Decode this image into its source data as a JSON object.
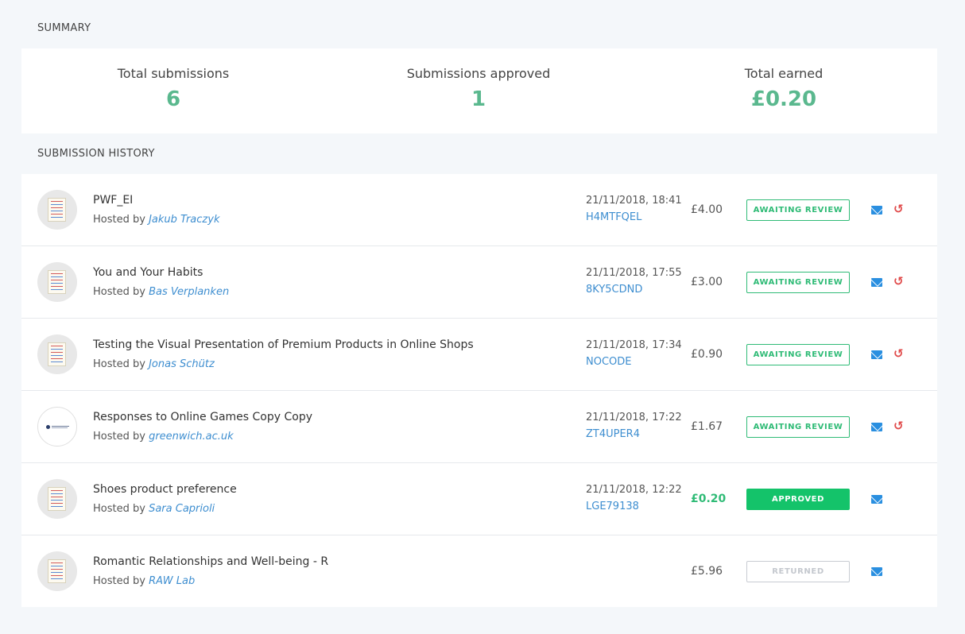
{
  "summary": {
    "title": "SUMMARY",
    "stats": [
      {
        "label": "Total submissions",
        "value": "6"
      },
      {
        "label": "Submissions approved",
        "value": "1"
      },
      {
        "label": "Total earned",
        "value": "£0.20"
      }
    ]
  },
  "history": {
    "title": "SUBMISSION HISTORY",
    "hosted_prefix": "Hosted by",
    "rows": [
      {
        "title": "PWF_EI",
        "host": "Jakub Traczyk",
        "date": "21/11/2018, 18:41",
        "code": "H4MTFQEL",
        "amount": "£4.00",
        "status": "AWAITING REVIEW"
      },
      {
        "title": "You and Your Habits",
        "host": "Bas Verplanken",
        "date": "21/11/2018, 17:55",
        "code": "8KY5CDND",
        "amount": "£3.00",
        "status": "AWAITING REVIEW"
      },
      {
        "title": "Testing the Visual Presentation of Premium Products in Online Shops",
        "host": "Jonas Schütz",
        "date": "21/11/2018, 17:34",
        "code": "NOCODE",
        "amount": "£0.90",
        "status": "AWAITING REVIEW"
      },
      {
        "title": "Responses to Online Games Copy Copy",
        "host": "greenwich.ac.uk",
        "date": "21/11/2018, 17:22",
        "code": "ZT4UPER4",
        "amount": "£1.67",
        "status": "AWAITING REVIEW"
      },
      {
        "title": "Shoes product preference",
        "host": "Sara Caprioli",
        "date": "21/11/2018, 12:22",
        "code": "LGE79138",
        "amount": "£0.20",
        "status": "APPROVED"
      },
      {
        "title": "Romantic Relationships and Well-being - R",
        "host": "RAW Lab",
        "date": "",
        "code": "",
        "amount": "£5.96",
        "status": "RETURNED"
      }
    ]
  },
  "icons": {
    "message": "envelope-icon",
    "return": "undo-icon",
    "study": "document-icon",
    "institution": "university-logo"
  },
  "colors": {
    "accent_green": "#5ab88e",
    "status_green": "#14c36a",
    "link_blue": "#3e8ed0",
    "undo_red": "#e04a4a"
  }
}
